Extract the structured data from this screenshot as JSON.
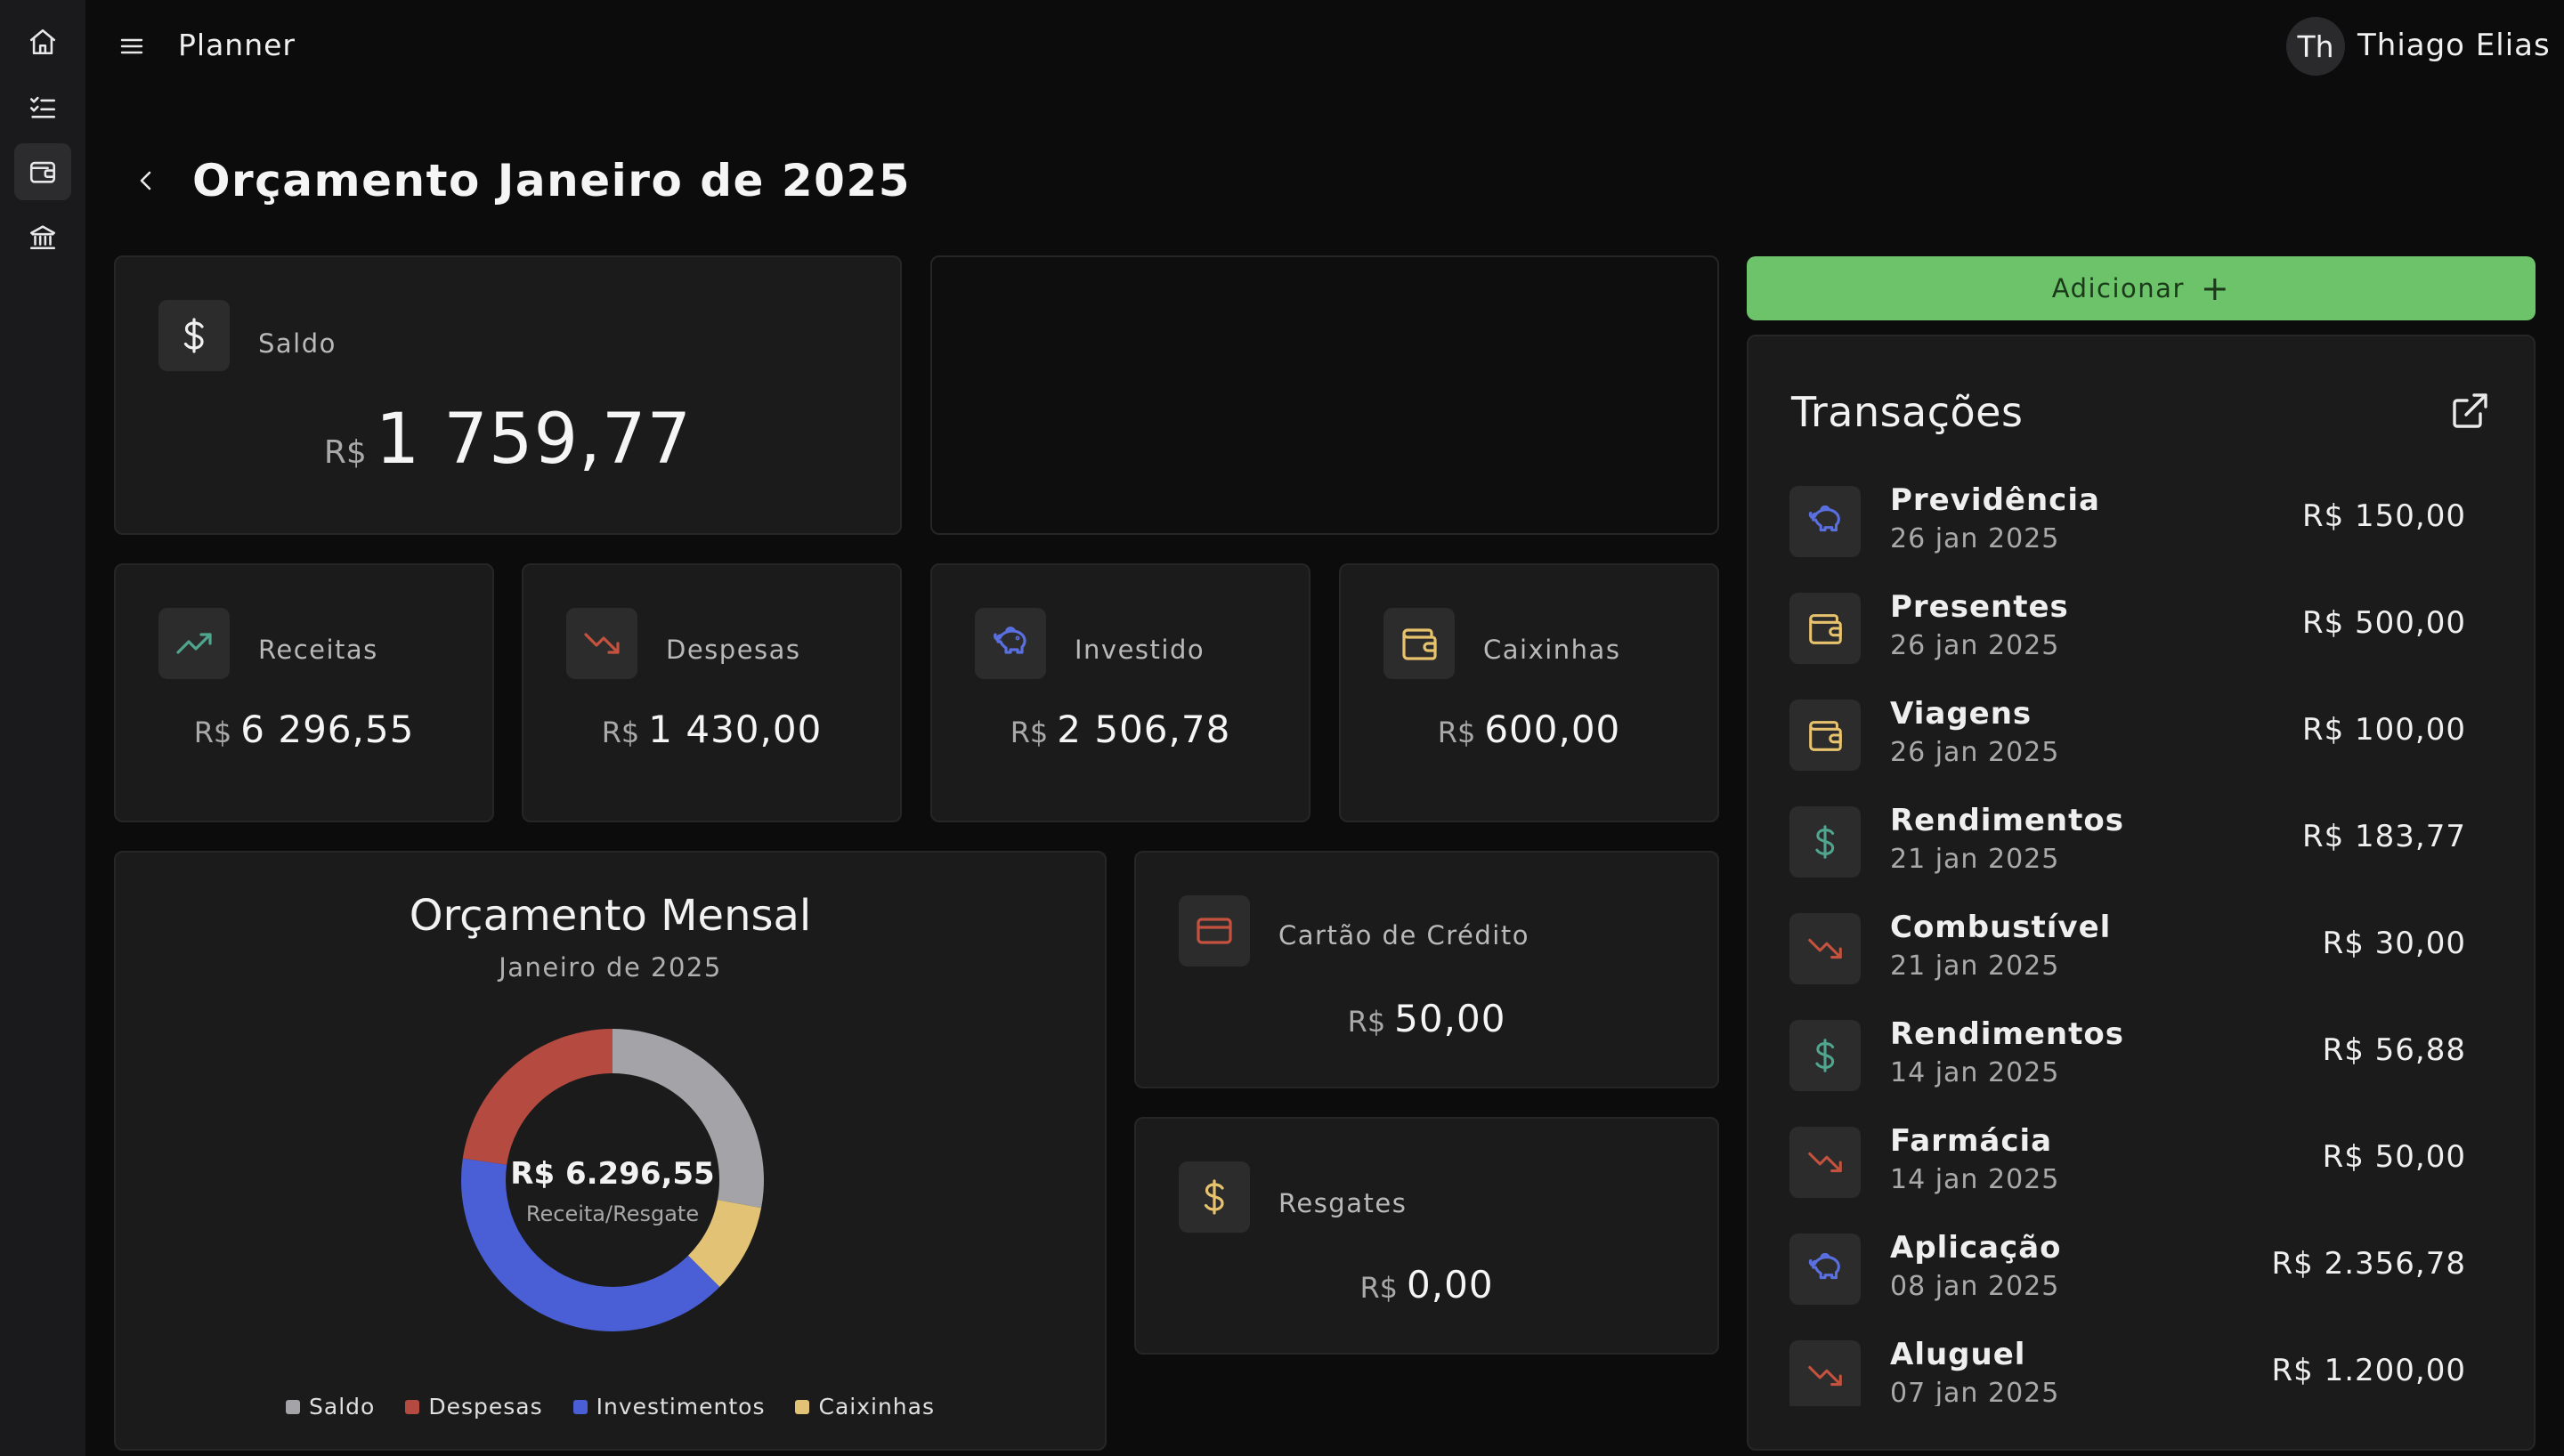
{
  "app": {
    "title": "Planner"
  },
  "user": {
    "initials": "Th",
    "name": "Thiago Elias"
  },
  "sidebar": {
    "items": [
      {
        "icon": "home-icon"
      },
      {
        "icon": "checklist-icon"
      },
      {
        "icon": "wallet-icon",
        "active": true
      },
      {
        "icon": "bank-icon"
      }
    ]
  },
  "page": {
    "title": "Orçamento Janeiro de 2025"
  },
  "saldo": {
    "label": "Saldo",
    "currency": "R$",
    "value": "1 759,77"
  },
  "stats": [
    {
      "key": "receitas",
      "label": "Receitas",
      "currency": "R$",
      "value": "6 296,55",
      "icon": "trending-up-icon",
      "color": "#4fa58d"
    },
    {
      "key": "despesas",
      "label": "Despesas",
      "currency": "R$",
      "value": "1 430,00",
      "icon": "trending-down-icon",
      "color": "#c4523f"
    },
    {
      "key": "investido",
      "label": "Investido",
      "currency": "R$",
      "value": "2 506,78",
      "icon": "piggy-bank-icon",
      "color": "#5a6fe0"
    },
    {
      "key": "caixinhas",
      "label": "Caixinhas",
      "currency": "R$",
      "value": "600,00",
      "icon": "wallet-icon",
      "color": "#e8c36e"
    }
  ],
  "cartao": {
    "label": "Cartão de Crédito",
    "currency": "R$",
    "value": "50,00",
    "icon": "credit-card-icon",
    "color": "#c4523f"
  },
  "resgates": {
    "label": "Resgates",
    "currency": "R$",
    "value": "0,00",
    "icon": "dollar-icon",
    "color": "#e8c36e"
  },
  "add_button": {
    "label": "Adicionar",
    "icon": "plus-icon"
  },
  "transactions": {
    "title": "Transações",
    "items": [
      {
        "name": "Previdência",
        "date": "26 jan 2025",
        "amount": "R$ 150,00",
        "icon": "piggy-bank-icon",
        "color": "#5a6fe0"
      },
      {
        "name": "Presentes",
        "date": "26 jan 2025",
        "amount": "R$ 500,00",
        "icon": "wallet-icon",
        "color": "#e8c36e"
      },
      {
        "name": "Viagens",
        "date": "26 jan 2025",
        "amount": "R$ 100,00",
        "icon": "wallet-icon",
        "color": "#e8c36e"
      },
      {
        "name": "Rendimentos",
        "date": "21 jan 2025",
        "amount": "R$ 183,77",
        "icon": "dollar-icon",
        "color": "#4fa58d"
      },
      {
        "name": "Combustível",
        "date": "21 jan 2025",
        "amount": "R$ 30,00",
        "icon": "trending-down-icon",
        "color": "#c4523f"
      },
      {
        "name": "Rendimentos",
        "date": "14 jan 2025",
        "amount": "R$ 56,88",
        "icon": "dollar-icon",
        "color": "#4fa58d"
      },
      {
        "name": "Farmácia",
        "date": "14 jan 2025",
        "amount": "R$ 50,00",
        "icon": "trending-down-icon",
        "color": "#c4523f"
      },
      {
        "name": "Aplicação",
        "date": "08 jan 2025",
        "amount": "R$ 2.356,78",
        "icon": "piggy-bank-icon",
        "color": "#5a6fe0"
      },
      {
        "name": "Aluguel",
        "date": "07 jan 2025",
        "amount": "R$ 1.200,00",
        "icon": "trending-down-icon",
        "color": "#c4523f"
      }
    ]
  },
  "chart_data": {
    "type": "pie",
    "title": "Orçamento Mensal",
    "subtitle": "Janeiro de 2025",
    "center_value": "R$ 6.296,55",
    "center_label": "Receita/Resgate",
    "legend_position": "bottom",
    "series": [
      {
        "name": "Saldo",
        "value": 1759.77,
        "color": "#a3a3a8"
      },
      {
        "name": "Despesas",
        "value": 1430.0,
        "color": "#b54a40"
      },
      {
        "name": "Investimentos",
        "value": 2506.78,
        "color": "#4a5fd6"
      },
      {
        "name": "Caixinhas",
        "value": 600.0,
        "color": "#e2c274"
      }
    ],
    "start_order": [
      "Saldo",
      "Caixinhas",
      "Investimentos",
      "Despesas"
    ]
  }
}
